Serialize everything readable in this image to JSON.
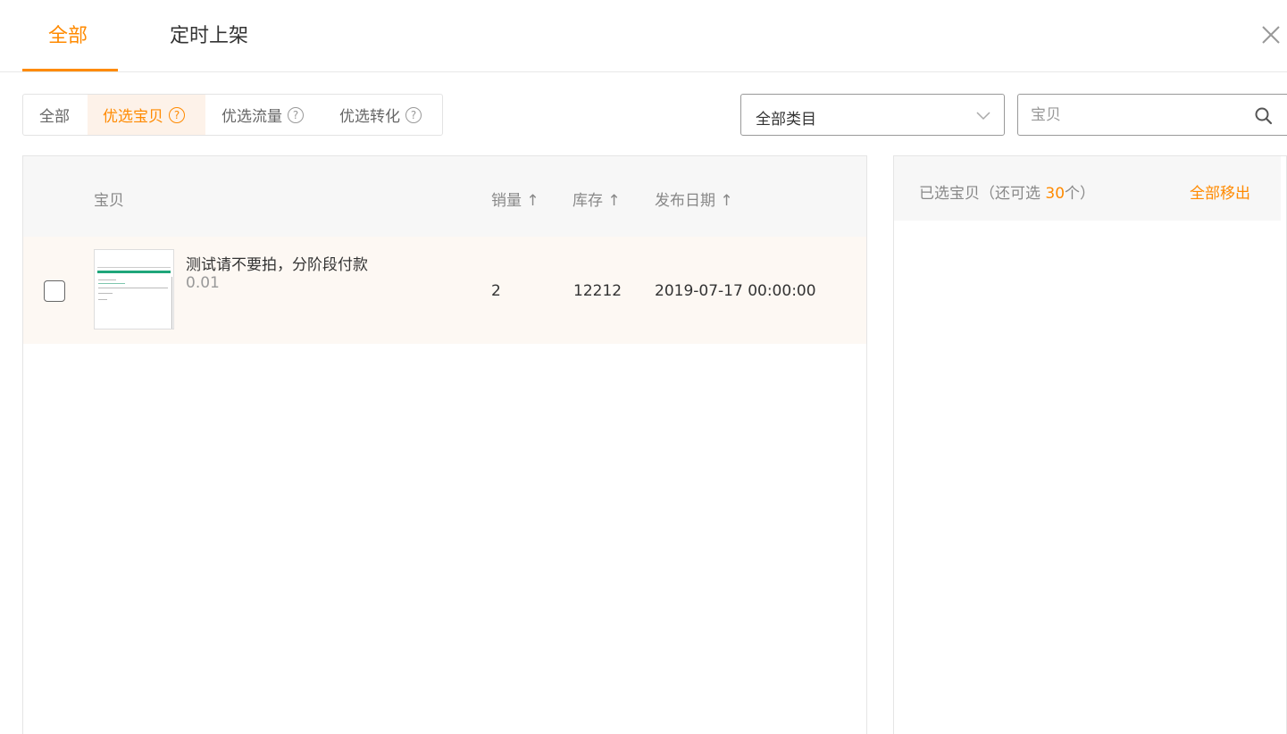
{
  "top_tabs": [
    {
      "label": "全部",
      "active": true
    },
    {
      "label": "定时上架",
      "active": false
    }
  ],
  "filters": [
    {
      "label": "全部",
      "help": false,
      "active": false
    },
    {
      "label": "优选宝贝",
      "help": true,
      "active": true
    },
    {
      "label": "优选流量",
      "help": true,
      "active": false
    },
    {
      "label": "优选转化",
      "help": true,
      "active": false
    }
  ],
  "help_glyph": "?",
  "category_select": {
    "value": "全部类目"
  },
  "search": {
    "placeholder": "宝贝",
    "value": ""
  },
  "table": {
    "columns": {
      "item": "宝贝",
      "sales": "销量 ↑",
      "stock": "库存 ↑",
      "date": "发布日期 ↑"
    },
    "rows": [
      {
        "title": "测试请不要拍，分阶段付款",
        "price": "0.01",
        "sales": "2",
        "stock": "12212",
        "date": "2019-07-17 00:00:00",
        "checked": false
      }
    ]
  },
  "selected_panel": {
    "label_prefix": "已选宝贝（还可选 ",
    "remaining": "30",
    "label_suffix": "个）",
    "remove_all": "全部移出"
  },
  "colors": {
    "accent": "#ff8a00",
    "active_bg": "#fdf2e9",
    "row_bg": "#fdf8f3",
    "header_bg": "#f7f7f7"
  }
}
